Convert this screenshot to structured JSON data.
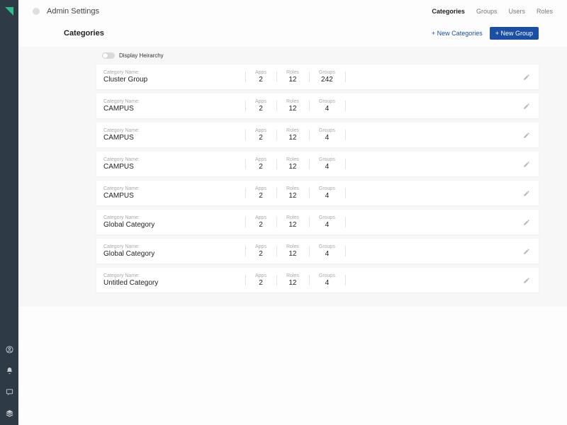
{
  "breadcrumb": "Admin Settings",
  "nav": {
    "items": [
      "Categories",
      "Groups",
      "Users",
      "Roles"
    ],
    "active_index": 0
  },
  "page_title": "Categories",
  "actions": {
    "new_categories": "+ New Categories",
    "new_group": "+ New Group"
  },
  "toggle_label": "Display Heirarchy",
  "labels": {
    "category_name": "Category Name:",
    "apps": "Apps",
    "roles": "Roles",
    "groups": "Groups"
  },
  "categories": [
    {
      "name": "Cluster Group",
      "apps": 2,
      "roles": 12,
      "groups": 242
    },
    {
      "name": "CAMPUS",
      "apps": 2,
      "roles": 12,
      "groups": 4
    },
    {
      "name": "CAMPUS",
      "apps": 2,
      "roles": 12,
      "groups": 4
    },
    {
      "name": "CAMPUS",
      "apps": 2,
      "roles": 12,
      "groups": 4
    },
    {
      "name": "CAMPUS",
      "apps": 2,
      "roles": 12,
      "groups": 4
    },
    {
      "name": "Global Category",
      "apps": 2,
      "roles": 12,
      "groups": 4
    },
    {
      "name": "Global Category",
      "apps": 2,
      "roles": 12,
      "groups": 4
    },
    {
      "name": "Untitled Category",
      "apps": 2,
      "roles": 12,
      "groups": 4
    }
  ]
}
